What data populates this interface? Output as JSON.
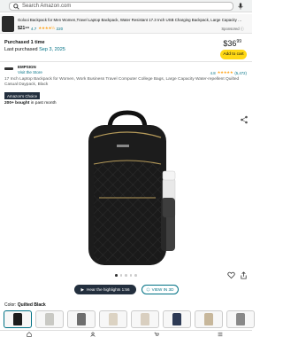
{
  "search": {
    "placeholder": "Search Amazon.com"
  },
  "ad": {
    "title": "Golooi Backpack for Men Women,Travel Laptop Backpack, Water Resistant 17.3 Inch USB Charging Backpack, Large Capacity Work...",
    "price": "$21⁹⁹",
    "rating": "4.7",
    "stars": "★★★★½",
    "count": "220",
    "sponsored": "Sponsored"
  },
  "purchase": {
    "line1": "Purchased 1 time",
    "line2_prefix": "Last purchased ",
    "line2_date": "Sep 3, 2025"
  },
  "price": {
    "dollars": "$36",
    "cents": "99"
  },
  "cart_label": "Add to cart",
  "brand": {
    "name": "EMPSIGN",
    "link": "Visit the Store",
    "rating": "4.8",
    "stars": "★★★★★",
    "count": "(5,472)"
  },
  "product_title": "17 Inch Laptop Backpack for Women, Work Business Travel Computer College Bags, Large Capacity Water-repellent Quilted Casual Daypack, Black",
  "badge": "Amazon's Choice",
  "bought": {
    "bold": "200+ bought",
    "rest": " in past month"
  },
  "highlights_label": "Hear the highlights 1:56",
  "view_label": "VIEW IN 3D",
  "color": {
    "prefix": "Color: ",
    "value": "Quilted Black"
  },
  "swatch_colors": [
    "#1c1c1c",
    "#c9c9c4",
    "#6e6e6e",
    "#dcd3c3",
    "#d9cfc0",
    "#2d3a55",
    "#c7b79b",
    "#888888"
  ],
  "colors": {
    "accent": "#007185",
    "cart": "#ffd814",
    "badge_bg": "#232f3e",
    "star": "#ffa41c"
  }
}
